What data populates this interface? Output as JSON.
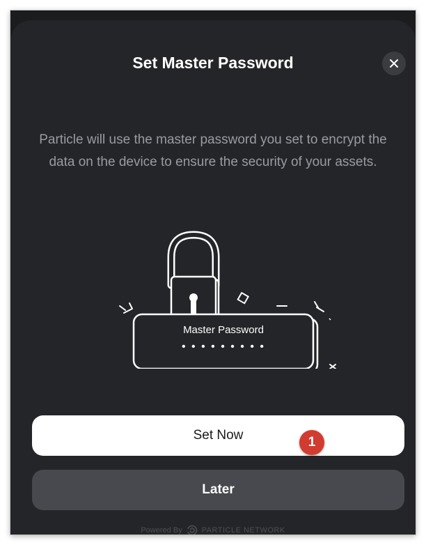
{
  "dialog": {
    "title": "Set Master Password",
    "description": "Particle will use the master password you set to encrypt the data on the device to ensure the security of your assets.",
    "illustration": {
      "label": "Master Password",
      "dots": "• • • • • • • • •"
    },
    "primary_button": "Set Now",
    "secondary_button": "Later",
    "badge": "1",
    "footer": {
      "powered_by": "Powered By",
      "brand": "PARTICLE NETWORK"
    }
  },
  "icons": {
    "close": "close-icon",
    "lock": "padlock-icon",
    "logo": "particle-logo-icon"
  },
  "colors": {
    "background": "#242528",
    "primary_button": "#ffffff",
    "secondary_button": "#48494e",
    "badge": "#d23b2f",
    "text_muted": "#9a9ba3"
  }
}
